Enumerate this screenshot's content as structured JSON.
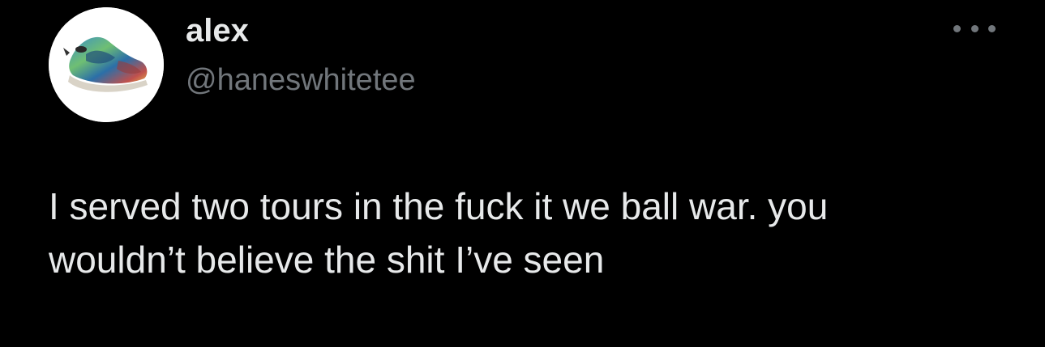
{
  "tweet": {
    "author": {
      "display_name": "alex",
      "handle": "@haneswhitetee",
      "avatar_icon": "sneaker-avatar-icon"
    },
    "more_icon": "more-horizontal-icon",
    "text_lines": [
      "I served two tours in the fuck it we ball war. you",
      "wouldn’t believe the shit I’ve seen"
    ]
  },
  "colors": {
    "background": "#000000",
    "primary_text": "#e7e9ea",
    "secondary_text": "#71767b"
  }
}
